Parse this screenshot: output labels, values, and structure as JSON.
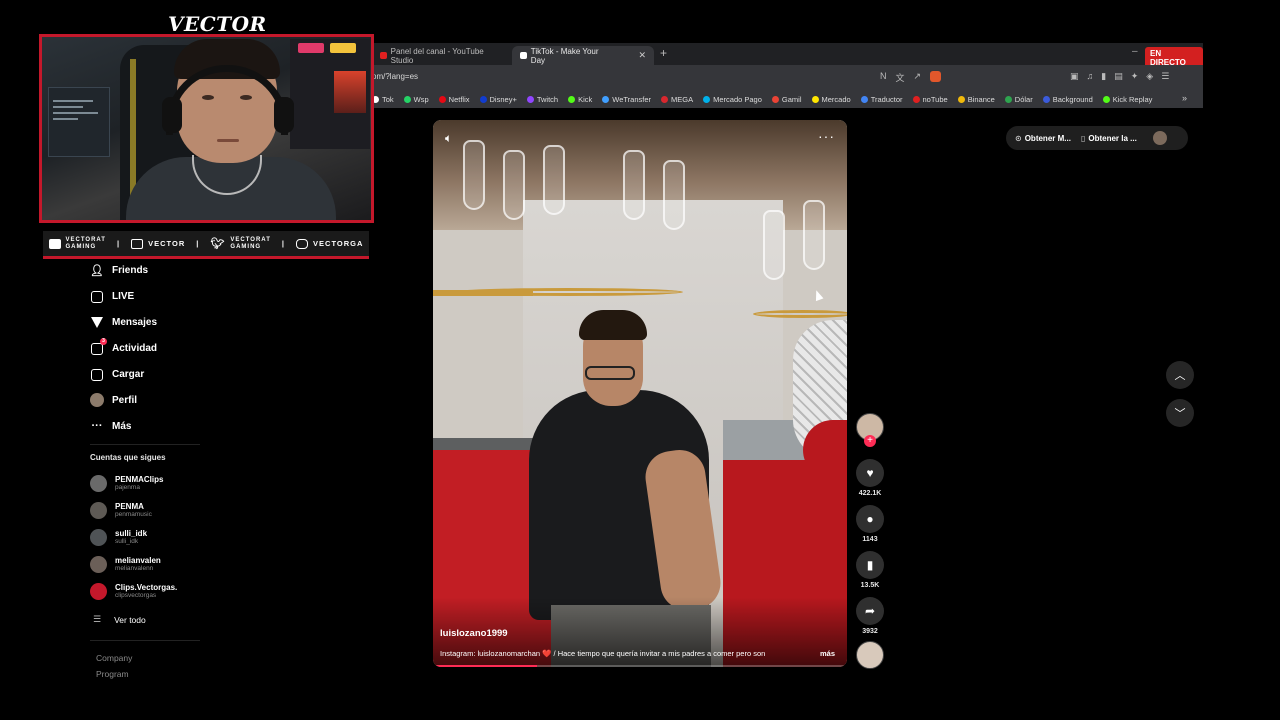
{
  "overlay": {
    "brand": "VECTOR",
    "socials": [
      {
        "icon": "youtube-icon",
        "label_top": "VECTORAT",
        "label_bottom": "GAMING"
      },
      {
        "icon": "twitch-icon",
        "label": "VECTOR"
      },
      {
        "icon": "twitter-icon",
        "label_top": "VECTORAT",
        "label_bottom": "GAMING"
      },
      {
        "icon": "instagram-icon",
        "label": "VECTORGA"
      }
    ]
  },
  "browser": {
    "tabs": [
      {
        "title": "Panel del canal - YouTube Studio",
        "active": false,
        "color": "#e02020"
      },
      {
        "title": "TikTok - Make Your Day",
        "active": true,
        "color": "#ffffff"
      }
    ],
    "new_tab": "+",
    "live_badge": "EN DIRECTO",
    "url": "om/?lang=es",
    "bookmarks": [
      {
        "label": "Tok",
        "color": "#ffffff"
      },
      {
        "label": "Wsp",
        "color": "#25d366"
      },
      {
        "label": "Netflix",
        "color": "#e50914"
      },
      {
        "label": "Disney+",
        "color": "#113ccf"
      },
      {
        "label": "Twitch",
        "color": "#9146ff"
      },
      {
        "label": "Kick",
        "color": "#53fc18"
      },
      {
        "label": "WeTransfer",
        "color": "#409fff"
      },
      {
        "label": "MEGA",
        "color": "#d9272e"
      },
      {
        "label": "Mercado Pago",
        "color": "#00b1ea"
      },
      {
        "label": "Gamil",
        "color": "#ea4335"
      },
      {
        "label": "Mercado",
        "color": "#ffe600"
      },
      {
        "label": "Traductor",
        "color": "#4285f4"
      },
      {
        "label": "noTube",
        "color": "#e02020"
      },
      {
        "label": "Binance",
        "color": "#f0b90b"
      },
      {
        "label": "Dólar",
        "color": "#2ea44f"
      },
      {
        "label": "Background",
        "color": "#3b5bdb"
      },
      {
        "label": "Kick Replay",
        "color": "#53fc18"
      }
    ],
    "bookmarks_more": "»"
  },
  "sidebar": {
    "nav": [
      {
        "label": "Friends",
        "icon": "friends-icon"
      },
      {
        "label": "LIVE",
        "icon": "live-icon"
      },
      {
        "label": "Mensajes",
        "icon": "messages-icon"
      },
      {
        "label": "Actividad",
        "icon": "activity-icon",
        "badge": "3"
      },
      {
        "label": "Cargar",
        "icon": "upload-icon"
      },
      {
        "label": "Perfil",
        "icon": "profile-icon"
      },
      {
        "label": "Más",
        "icon": "more-icon"
      }
    ],
    "following_title": "Cuentas que sigues",
    "following": [
      {
        "name": "PENMAClips",
        "handle": "pajenma"
      },
      {
        "name": "PENMA",
        "handle": "penmamusic"
      },
      {
        "name": "sulli_idk",
        "handle": "sulli_idk"
      },
      {
        "name": "melianvalen",
        "handle": "melianvalenn"
      },
      {
        "name": "Clips.Vectorgas.",
        "handle": "clipsvectorgas"
      }
    ],
    "see_all": "Ver todo",
    "footer": [
      "Company",
      "Program"
    ]
  },
  "video": {
    "username": "luislozano1999",
    "caption": "Instagram: luislozanomarchan ❤️ / Hace tiempo que quería invitar a mis padres a comer pero son",
    "more": "más",
    "progress": 0.25
  },
  "actions": {
    "like_count": "422.1K",
    "comment_count": "1143",
    "save_count": "13.5K",
    "share_count": "3932"
  },
  "right": {
    "get_app_1": "Obtener M...",
    "get_app_2": "Obtener la ..."
  }
}
